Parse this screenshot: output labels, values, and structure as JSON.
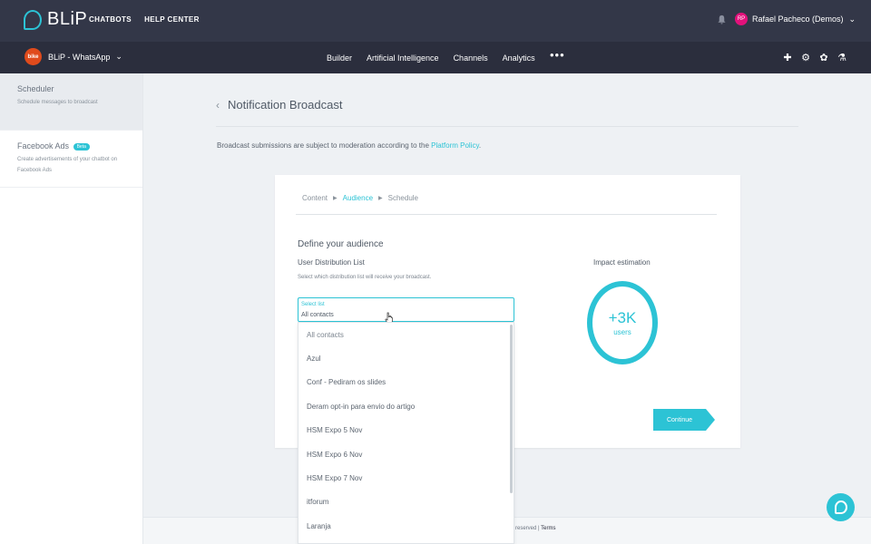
{
  "app": {
    "logo_text": "BLiP"
  },
  "topnav": {
    "items": [
      "CHATBOTS",
      "HELP CENTER"
    ]
  },
  "user": {
    "avatar_text": "RP",
    "name": "Rafael Pacheco (Demos)"
  },
  "bot": {
    "avatar_text": "bike",
    "name": "BLiP - WhatsApp"
  },
  "mainnav": {
    "items": [
      "Builder",
      "Artificial Intelligence",
      "Channels",
      "Analytics"
    ],
    "more": "•••"
  },
  "sidebar": {
    "items": [
      {
        "title": "Scheduler",
        "desc": "Schedule messages to broadcast"
      },
      {
        "title": "Facebook Ads",
        "badge": "Beta",
        "desc": "Create advertisements of your chatbot on Facebook Ads"
      }
    ]
  },
  "page": {
    "title": "Notification Broadcast",
    "moderation_text": "Broadcast submissions are subject to moderation according to the ",
    "policy_link": "Platform Policy",
    "policy_end": "."
  },
  "steps": [
    "Content",
    "Audience",
    "Schedule"
  ],
  "audience": {
    "heading": "Define your audience",
    "list_title": "User Distribution List",
    "list_desc": "Select which distribution list will receive your broadcast.",
    "select_label": "Select list",
    "select_value": "All contacts",
    "options": [
      "All contacts",
      "Azul",
      "Conf - Pediram os slides",
      "Deram opt-in para envio do artigo",
      "HSM Expo 5 Nov",
      "HSM Expo 6 Nov",
      "HSM Expo 7 Nov",
      "itforum",
      "Laranja"
    ]
  },
  "impact": {
    "label": "Impact estimation",
    "value": "+3K",
    "unit": "users"
  },
  "buttons": {
    "continue": "Continue"
  },
  "footer": {
    "text": "reserved | ",
    "terms": "Terms"
  },
  "colors": {
    "accent": "#2cc3d5",
    "topbar": "#333748",
    "subbar": "#2b2e3d"
  }
}
